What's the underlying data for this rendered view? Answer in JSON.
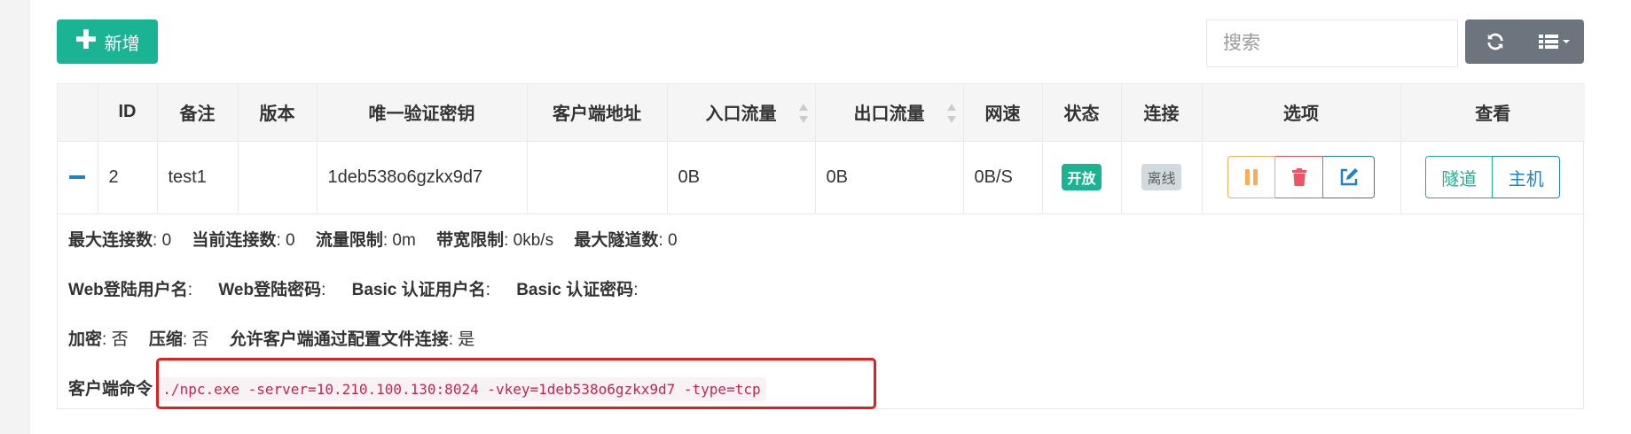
{
  "toolbar": {
    "add_label": "新增",
    "search_placeholder": "搜索",
    "refresh_icon": "refresh-icon",
    "columns_icon": "list-columns-icon"
  },
  "table": {
    "headers": [
      "",
      "ID",
      "备注",
      "版本",
      "唯一验证密钥",
      "客户端地址",
      "入口流量",
      "出口流量",
      "网速",
      "状态",
      "连接",
      "选项",
      "查看"
    ],
    "row": {
      "id": "2",
      "remark": "test1",
      "version": "",
      "vkey": "1deb538o6gzkx9d7",
      "address": "",
      "in_flow": "0B",
      "out_flow": "0B",
      "speed": "0B/S",
      "status": "开放",
      "connection": "离线",
      "view_tunnel": "隧道",
      "view_host": "主机"
    }
  },
  "detail": {
    "max_conn_label": "最大连接数",
    "max_conn": ": 0",
    "cur_conn_label": "当前连接数",
    "cur_conn": ": 0",
    "flow_limit_label": "流量限制",
    "flow_limit": ": 0m",
    "rate_limit_label": "带宽限制",
    "rate_limit": ": 0kb/s",
    "max_tunnel_label": "最大隧道数",
    "max_tunnel": ": 0",
    "web_user_label": "Web登陆用户名",
    "web_user": ":",
    "web_pass_label": "Web登陆密码",
    "web_pass": ":",
    "basic_user_label": "Basic 认证用户名",
    "basic_user": ":",
    "basic_pass_label": "Basic 认证密码",
    "basic_pass": ":",
    "crypt_label": "加密",
    "crypt": ": 否",
    "compress_label": "压缩",
    "compress": ": 否",
    "config_conn_label": "允许客户端通过配置文件连接",
    "config_conn": ": 是",
    "command_label": "客户端命令",
    "command": "./npc.exe -server=10.210.100.130:8024 -vkey=1deb538o6gzkx9d7 -type=tcp"
  },
  "colors": {
    "primary": "#1ab394",
    "info": "#1c84c6",
    "warning": "#f8ac59",
    "danger": "#ed5565",
    "highlight": "#e02020"
  }
}
